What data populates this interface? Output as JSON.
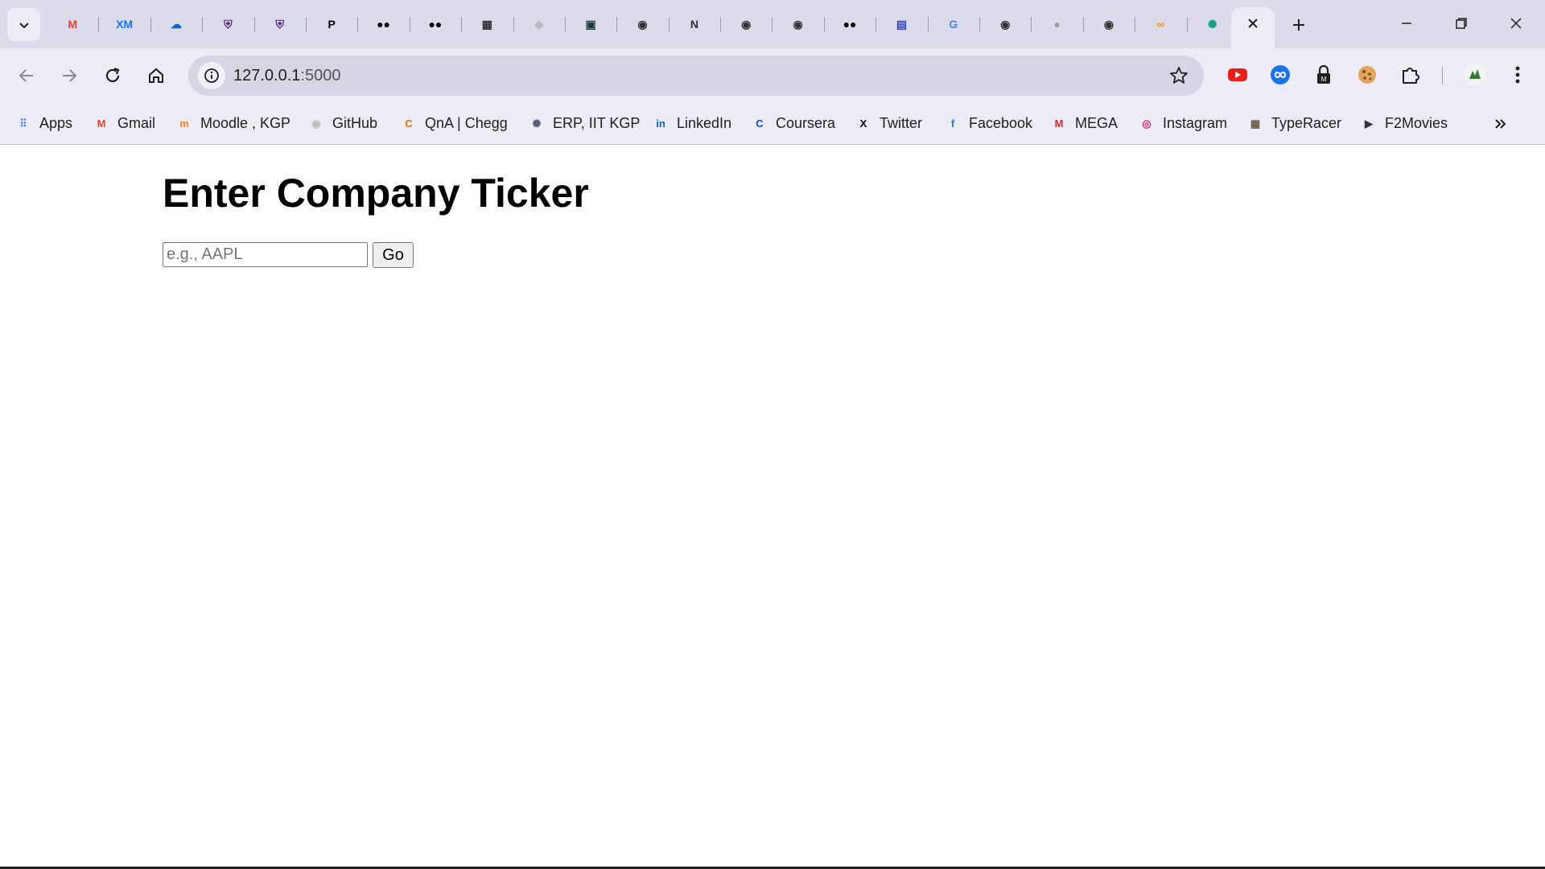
{
  "browser": {
    "tabs": [
      {
        "icon": "gmail-icon",
        "glyph": "M",
        "color": "#ea4335"
      },
      {
        "icon": "xm-icon",
        "glyph": "XM",
        "color": "#1a73e8"
      },
      {
        "icon": "onedrive-icon",
        "glyph": "☁",
        "color": "#0a66c2"
      },
      {
        "icon": "shield-crest-icon",
        "glyph": "⛨",
        "color": "#5b2a86"
      },
      {
        "icon": "shield-crest-icon",
        "glyph": "⛨",
        "color": "#5b2a86"
      },
      {
        "icon": "p-icon",
        "glyph": "P",
        "color": "#000000"
      },
      {
        "icon": "medium-icon",
        "glyph": "●●",
        "color": "#000000"
      },
      {
        "icon": "medium-icon",
        "glyph": "●●",
        "color": "#000000"
      },
      {
        "icon": "pattern-icon",
        "glyph": "▦",
        "color": "#333333"
      },
      {
        "icon": "cube-icon",
        "glyph": "◆",
        "color": "#bbbbbb"
      },
      {
        "icon": "robot-icon",
        "glyph": "▣",
        "color": "#1f3b3b"
      },
      {
        "icon": "github-icon",
        "glyph": "◉",
        "color": "#333333"
      },
      {
        "icon": "nimc-icon",
        "glyph": "N",
        "color": "#333333"
      },
      {
        "icon": "github-icon",
        "glyph": "◉",
        "color": "#333333"
      },
      {
        "icon": "github-icon",
        "glyph": "◉",
        "color": "#333333"
      },
      {
        "icon": "medium-icon",
        "glyph": "●●",
        "color": "#000000"
      },
      {
        "icon": "layout-icon",
        "glyph": "▤",
        "color": "#3949ab"
      },
      {
        "icon": "google-icon",
        "glyph": "G",
        "color": "#4285f4"
      },
      {
        "icon": "github-icon",
        "glyph": "◉",
        "color": "#333333"
      },
      {
        "icon": "globe-icon",
        "glyph": "●",
        "color": "#9e9e9e"
      },
      {
        "icon": "github-icon",
        "glyph": "◉",
        "color": "#333333"
      },
      {
        "icon": "infinity-icon",
        "glyph": "∞",
        "color": "#f39c12"
      },
      {
        "icon": "chatgpt-icon",
        "glyph": "✺",
        "color": "#10a37f"
      }
    ],
    "address_bar": {
      "host": "127.0.0.1",
      "port": ":5000"
    },
    "bookmarks": [
      {
        "label": "Apps",
        "icon": "apps-grid-icon",
        "glyph": "⠿",
        "color": "#4285f4"
      },
      {
        "label": "Gmail",
        "icon": "gmail-icon",
        "glyph": "M",
        "color": "#ea4335"
      },
      {
        "label": "Moodle , KGP",
        "icon": "moodle-icon",
        "glyph": "m",
        "color": "#f98012"
      },
      {
        "label": "GitHub",
        "icon": "github-icon",
        "glyph": "◉",
        "color": "#bbbbbb"
      },
      {
        "label": "QnA | Chegg",
        "icon": "chegg-icon",
        "glyph": "C",
        "color": "#eb7100"
      },
      {
        "label": "ERP, IIT KGP",
        "icon": "iit-crest-icon",
        "glyph": "✺",
        "color": "#5a5a7a"
      },
      {
        "label": "LinkedIn",
        "icon": "linkedin-icon",
        "glyph": "in",
        "color": "#0a66c2"
      },
      {
        "label": "Coursera",
        "icon": "coursera-icon",
        "glyph": "C",
        "color": "#0056d2"
      },
      {
        "label": "Twitter",
        "icon": "x-twitter-icon",
        "glyph": "X",
        "color": "#000000"
      },
      {
        "label": "Facebook",
        "icon": "facebook-icon",
        "glyph": "f",
        "color": "#1877f2"
      },
      {
        "label": "MEGA",
        "icon": "mega-icon",
        "glyph": "M",
        "color": "#d9272e"
      },
      {
        "label": "Instagram",
        "icon": "instagram-icon",
        "glyph": "◎",
        "color": "#d62976"
      },
      {
        "label": "TypeRacer",
        "icon": "typeracer-icon",
        "glyph": "▦",
        "color": "#6b5b3e"
      },
      {
        "label": "F2Movies",
        "icon": "f2movies-icon",
        "glyph": "▶",
        "color": "#333333"
      }
    ]
  },
  "page": {
    "title": "Enter Company Ticker",
    "input_placeholder": "e.g., AAPL",
    "go_label": "Go"
  },
  "colors": {
    "tabstrip": "#dcdbeb",
    "toolbar": "#ecebf6",
    "omnibox": "#d6d5e3"
  }
}
